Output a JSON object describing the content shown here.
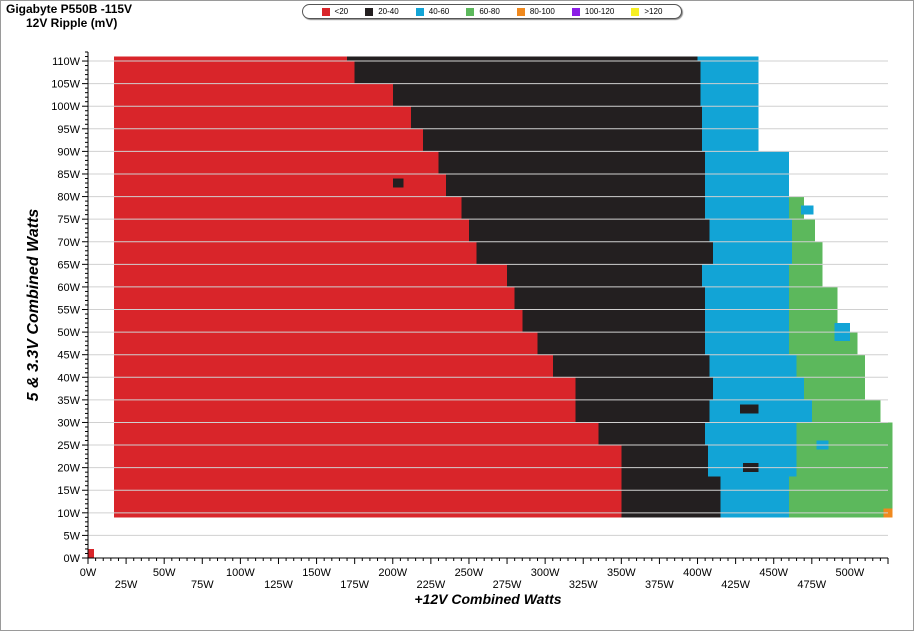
{
  "title": "Gigabyte P550B -115V",
  "subtitle": "12V Ripple (mV)",
  "legend": [
    {
      "label": "<20",
      "color": "#d9252a"
    },
    {
      "label": "20-40",
      "color": "#231f20"
    },
    {
      "label": "40-60",
      "color": "#12a4d6"
    },
    {
      "label": "60-80",
      "color": "#5cb85c"
    },
    {
      "label": "80-100",
      "color": "#f0891e"
    },
    {
      "label": "100-120",
      "color": "#8b1ee6"
    },
    {
      "label": ">120",
      "color": "#f7ef23"
    }
  ],
  "chart_data": {
    "type": "heatmap",
    "title": "Gigabyte P550B -115V",
    "subtitle": "12V Ripple (mV)",
    "xlabel": "+12V Combined Watts",
    "ylabel": "5 & 3.3V Combined Watts",
    "xlim": [
      0,
      525
    ],
    "ylim": [
      0,
      112
    ],
    "grid": true,
    "legend_position": "top",
    "x_ticks": [
      "0W",
      "25W",
      "50W",
      "75W",
      "100W",
      "125W",
      "150W",
      "175W",
      "200W",
      "225W",
      "250W",
      "275W",
      "300W",
      "325W",
      "350W",
      "375W",
      "400W",
      "425W",
      "450W",
      "475W",
      "500W"
    ],
    "y_ticks": [
      "0W",
      "5W",
      "10W",
      "15W",
      "20W",
      "25W",
      "30W",
      "35W",
      "40W",
      "45W",
      "50W",
      "55W",
      "60W",
      "65W",
      "70W",
      "75W",
      "80W",
      "85W",
      "90W",
      "95W",
      "100W",
      "105W",
      "110W"
    ],
    "rows": [
      {
        "y_from": 9,
        "y_to": 11,
        "bands": [
          [
            17,
            "<20"
          ],
          [
            350,
            "20-40"
          ],
          [
            415,
            "40-60"
          ],
          [
            460,
            "60-80"
          ],
          [
            522,
            "80-100"
          ],
          [
            528,
            "end"
          ]
        ]
      },
      {
        "y_from": 11,
        "y_to": 18,
        "bands": [
          [
            17,
            "<20"
          ],
          [
            350,
            "20-40"
          ],
          [
            415,
            "40-60"
          ],
          [
            460,
            "60-80"
          ],
          [
            528,
            "end"
          ]
        ]
      },
      {
        "y_from": 18,
        "y_to": 25,
        "bands": [
          [
            17,
            "<20"
          ],
          [
            350,
            "20-40"
          ],
          [
            407,
            "40-60"
          ],
          [
            465,
            "60-80"
          ],
          [
            528,
            "end"
          ]
        ]
      },
      {
        "y_from": 25,
        "y_to": 30,
        "bands": [
          [
            17,
            "<20"
          ],
          [
            335,
            "20-40"
          ],
          [
            405,
            "40-60"
          ],
          [
            465,
            "60-80"
          ],
          [
            528,
            "end"
          ]
        ]
      },
      {
        "y_from": 30,
        "y_to": 35,
        "bands": [
          [
            17,
            "<20"
          ],
          [
            320,
            "20-40"
          ],
          [
            408,
            "40-60"
          ],
          [
            475,
            "60-80"
          ],
          [
            520,
            "end"
          ]
        ]
      },
      {
        "y_from": 35,
        "y_to": 40,
        "bands": [
          [
            17,
            "<20"
          ],
          [
            320,
            "20-40"
          ],
          [
            410,
            "40-60"
          ],
          [
            470,
            "60-80"
          ],
          [
            510,
            "end"
          ]
        ]
      },
      {
        "y_from": 40,
        "y_to": 45,
        "bands": [
          [
            17,
            "<20"
          ],
          [
            305,
            "20-40"
          ],
          [
            408,
            "40-60"
          ],
          [
            465,
            "60-80"
          ],
          [
            510,
            "end"
          ]
        ]
      },
      {
        "y_from": 45,
        "y_to": 50,
        "bands": [
          [
            17,
            "<20"
          ],
          [
            295,
            "20-40"
          ],
          [
            405,
            "40-60"
          ],
          [
            460,
            "60-80"
          ],
          [
            505,
            "end"
          ]
        ]
      },
      {
        "y_from": 50,
        "y_to": 55,
        "bands": [
          [
            17,
            "<20"
          ],
          [
            285,
            "20-40"
          ],
          [
            405,
            "40-60"
          ],
          [
            460,
            "60-80"
          ],
          [
            492,
            "end"
          ]
        ]
      },
      {
        "y_from": 55,
        "y_to": 60,
        "bands": [
          [
            17,
            "<20"
          ],
          [
            280,
            "20-40"
          ],
          [
            405,
            "40-60"
          ],
          [
            460,
            "60-80"
          ],
          [
            492,
            "end"
          ]
        ]
      },
      {
        "y_from": 60,
        "y_to": 65,
        "bands": [
          [
            17,
            "<20"
          ],
          [
            275,
            "20-40"
          ],
          [
            403,
            "40-60"
          ],
          [
            460,
            "60-80"
          ],
          [
            482,
            "end"
          ]
        ]
      },
      {
        "y_from": 65,
        "y_to": 70,
        "bands": [
          [
            17,
            "<20"
          ],
          [
            255,
            "20-40"
          ],
          [
            410,
            "40-60"
          ],
          [
            462,
            "60-80"
          ],
          [
            482,
            "end"
          ]
        ]
      },
      {
        "y_from": 70,
        "y_to": 75,
        "bands": [
          [
            17,
            "<20"
          ],
          [
            250,
            "20-40"
          ],
          [
            408,
            "40-60"
          ],
          [
            462,
            "60-80"
          ],
          [
            477,
            "end"
          ]
        ]
      },
      {
        "y_from": 75,
        "y_to": 80,
        "bands": [
          [
            17,
            "<20"
          ],
          [
            245,
            "20-40"
          ],
          [
            405,
            "40-60"
          ],
          [
            460,
            "60-80"
          ],
          [
            470,
            "end"
          ]
        ]
      },
      {
        "y_from": 80,
        "y_to": 85,
        "bands": [
          [
            17,
            "<20"
          ],
          [
            235,
            "20-40"
          ],
          [
            405,
            "40-60"
          ],
          [
            460,
            "end"
          ]
        ]
      },
      {
        "y_from": 85,
        "y_to": 90,
        "bands": [
          [
            17,
            "<20"
          ],
          [
            230,
            "20-40"
          ],
          [
            405,
            "40-60"
          ],
          [
            460,
            "end"
          ]
        ]
      },
      {
        "y_from": 90,
        "y_to": 95,
        "bands": [
          [
            17,
            "<20"
          ],
          [
            220,
            "20-40"
          ],
          [
            403,
            "40-60"
          ],
          [
            440,
            "end"
          ]
        ]
      },
      {
        "y_from": 95,
        "y_to": 100,
        "bands": [
          [
            17,
            "<20"
          ],
          [
            212,
            "20-40"
          ],
          [
            403,
            "40-60"
          ],
          [
            440,
            "end"
          ]
        ]
      },
      {
        "y_from": 100,
        "y_to": 105,
        "bands": [
          [
            17,
            "<20"
          ],
          [
            200,
            "20-40"
          ],
          [
            402,
            "40-60"
          ],
          [
            440,
            "end"
          ]
        ]
      },
      {
        "y_from": 105,
        "y_to": 110,
        "bands": [
          [
            17,
            "<20"
          ],
          [
            175,
            "20-40"
          ],
          [
            402,
            "40-60"
          ],
          [
            440,
            "end"
          ]
        ]
      },
      {
        "y_from": 110,
        "y_to": 111,
        "bands": [
          [
            17,
            "<20"
          ],
          [
            170,
            "20-40"
          ],
          [
            400,
            "40-60"
          ],
          [
            440,
            "end"
          ]
        ]
      }
    ],
    "spots": [
      {
        "x": 0,
        "x2": 4,
        "y": 0,
        "y2": 2,
        "category": "<20"
      },
      {
        "x": 178,
        "x2": 185,
        "y": 108,
        "y2": 110,
        "category": "20-40"
      },
      {
        "x": 200,
        "x2": 207,
        "y": 82,
        "y2": 84,
        "category": "20-40"
      },
      {
        "x": 330,
        "x2": 345,
        "y": 20,
        "y2": 23,
        "category": "<20"
      },
      {
        "x": 300,
        "x2": 307,
        "y": 28,
        "y2": 30,
        "category": "<20"
      },
      {
        "x": 430,
        "x2": 440,
        "y": 19,
        "y2": 21,
        "category": "20-40"
      },
      {
        "x": 428,
        "x2": 440,
        "y": 32,
        "y2": 34,
        "category": "20-40"
      },
      {
        "x": 478,
        "x2": 486,
        "y": 24,
        "y2": 26,
        "category": "40-60"
      },
      {
        "x": 490,
        "x2": 500,
        "y": 48,
        "y2": 52,
        "category": "40-60"
      },
      {
        "x": 468,
        "x2": 476,
        "y": 76,
        "y2": 78,
        "category": "40-60"
      }
    ]
  },
  "axis": {
    "x_label": "+12V Combined Watts",
    "y_label": "5 & 3.3V Combined Watts"
  }
}
